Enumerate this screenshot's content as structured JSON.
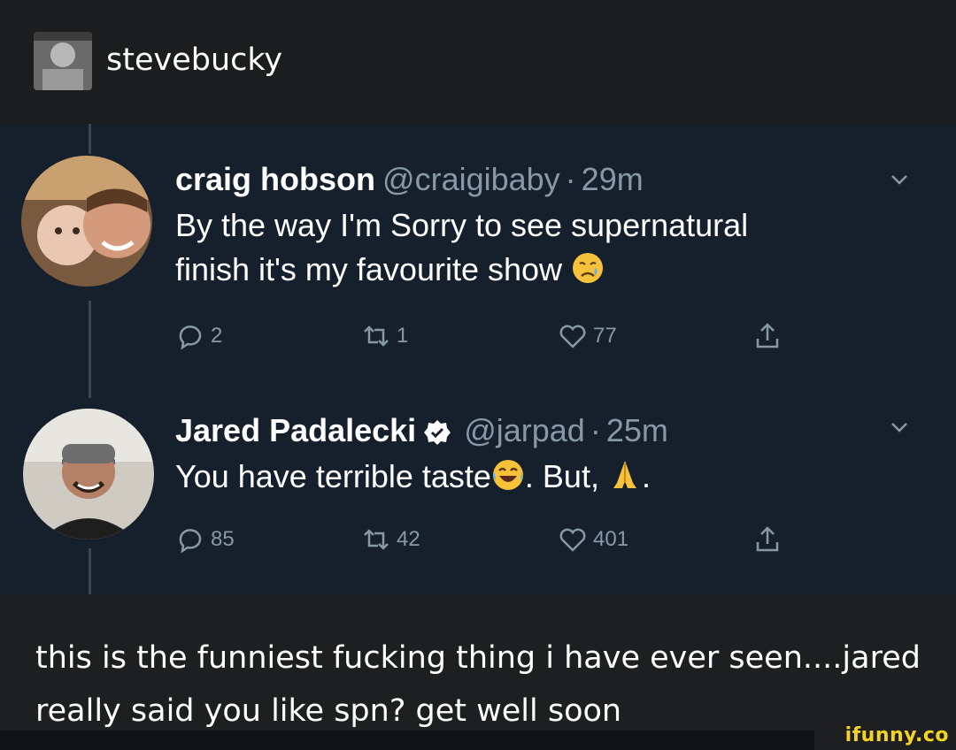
{
  "blog": {
    "username": "stevebucky"
  },
  "tweets": [
    {
      "name": "craig hobson",
      "handle": "@craigibaby",
      "time": "29m",
      "line1": "By the way I'm Sorry to see supernatural",
      "line2": "finish it's my favourite show",
      "replies": "2",
      "retweets": "1",
      "likes": "77",
      "verified": false
    },
    {
      "name": "Jared Padalecki",
      "handle": "@jarpad",
      "time": "25m",
      "text_a": "You have terrible taste",
      "text_b": ". But,",
      "text_c": ".",
      "replies": "85",
      "retweets": "42",
      "likes": "401",
      "verified": true
    }
  ],
  "caption": {
    "text": "this is the funniest fucking thing i have ever seen....jared really said you like spn? get well soon"
  },
  "watermark": "ifunny.co",
  "colors": {
    "tweet_bg": "#15202c",
    "page_bg": "#1d1f21",
    "muted": "#8899a6",
    "watermark": "#f7d51d"
  }
}
